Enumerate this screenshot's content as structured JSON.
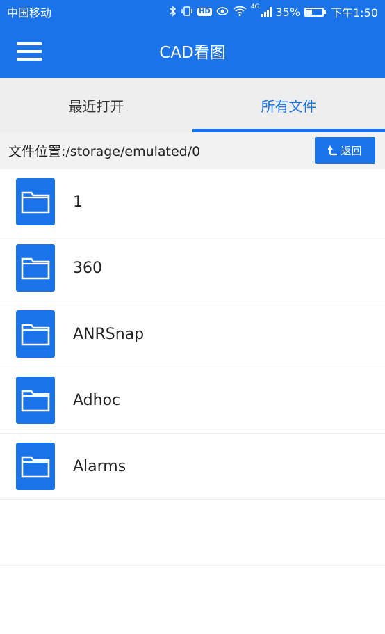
{
  "status_bar": {
    "carrier": "中国移动",
    "battery": "35%",
    "battery_level": 0.35,
    "time": "下午1:50",
    "network": "4G",
    "icons": [
      "bluetooth-icon",
      "vibrate-icon",
      "hd-icon",
      "eye-icon",
      "wifi-icon",
      "signal-icon",
      "battery-icon"
    ],
    "hd_label": "HD"
  },
  "app_bar": {
    "title": "CAD看图",
    "menu_icon": "hamburger-menu-icon"
  },
  "tabs": [
    {
      "label": "最近打开",
      "active": false
    },
    {
      "label": "所有文件",
      "active": true
    }
  ],
  "path_bar": {
    "text": "文件位置:/storage/emulated/0",
    "back_label": "返回",
    "back_icon": "return-arrow-icon"
  },
  "files": [
    {
      "name": "1",
      "icon": "folder-icon"
    },
    {
      "name": "360",
      "icon": "folder-icon"
    },
    {
      "name": "ANRSnap",
      "icon": "folder-icon"
    },
    {
      "name": "Adhoc",
      "icon": "folder-icon"
    },
    {
      "name": "Alarms",
      "icon": "folder-icon"
    }
  ],
  "colors": {
    "accent": "#1a73e8",
    "tab_bg": "#eeeeee",
    "path_bg": "#f2f2f2"
  }
}
